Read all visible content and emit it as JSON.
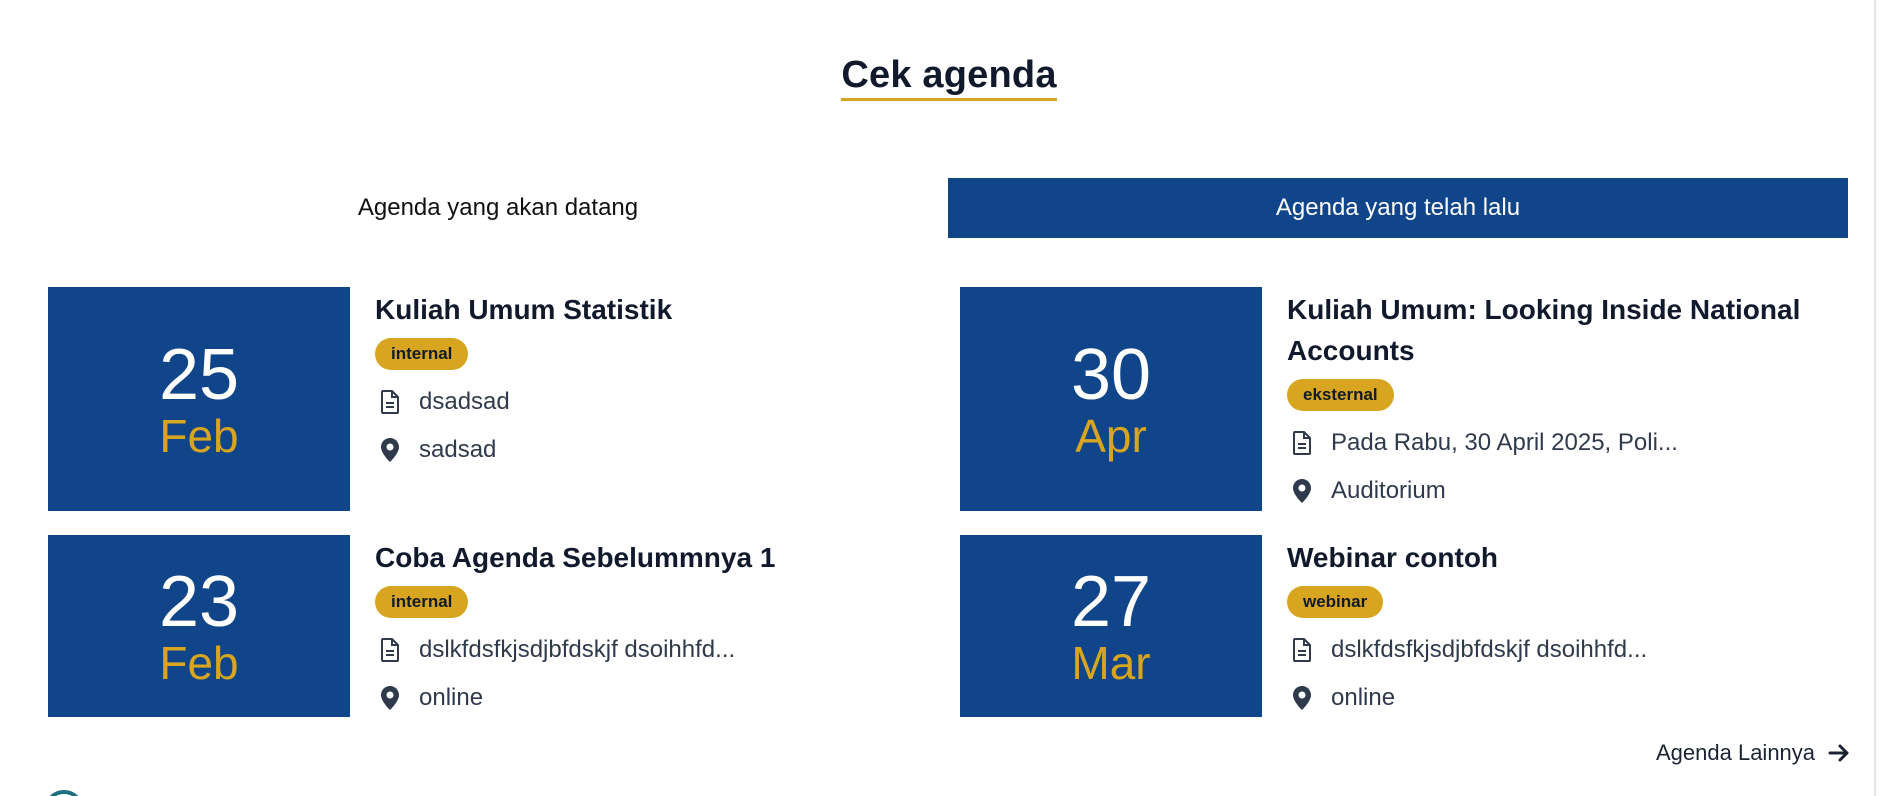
{
  "section": {
    "title": "Cek agenda"
  },
  "tabs": [
    {
      "label": "Agenda yang akan datang",
      "active": false
    },
    {
      "label": "Agenda yang telah lalu",
      "active": true
    }
  ],
  "upcoming": [
    {
      "day": "25",
      "month": "Feb",
      "title": "Kuliah Umum Statistik",
      "badge": "internal",
      "description": "dsadsad",
      "location": "sadsad"
    },
    {
      "day": "23",
      "month": "Feb",
      "title": "Coba Agenda  Sebelummnya 1",
      "badge": "internal",
      "description": "dslkfdsfkjsdjbfdskjf  dsoihhfd...",
      "location": "online"
    }
  ],
  "past": [
    {
      "day": "30",
      "month": "Apr",
      "title": "Kuliah Umum: Looking Inside National Accounts",
      "badge": "eksternal",
      "description": "Pada Rabu, 30 April 2025, Poli...",
      "location": "Auditorium"
    },
    {
      "day": "27",
      "month": "Mar",
      "title": "Webinar contoh",
      "badge": "webinar",
      "description": "dslkfdsfkjsdjbfdskjf  dsoihhfd...",
      "location": "online"
    }
  ],
  "more_link": {
    "label": "Agenda Lainnya",
    "icon": "arrow-right-icon"
  },
  "icons": {
    "description": "document-icon",
    "location": "map-pin-icon"
  },
  "colors": {
    "primary": "#114589",
    "accent": "#d7a51f",
    "text": "#111a2c"
  }
}
